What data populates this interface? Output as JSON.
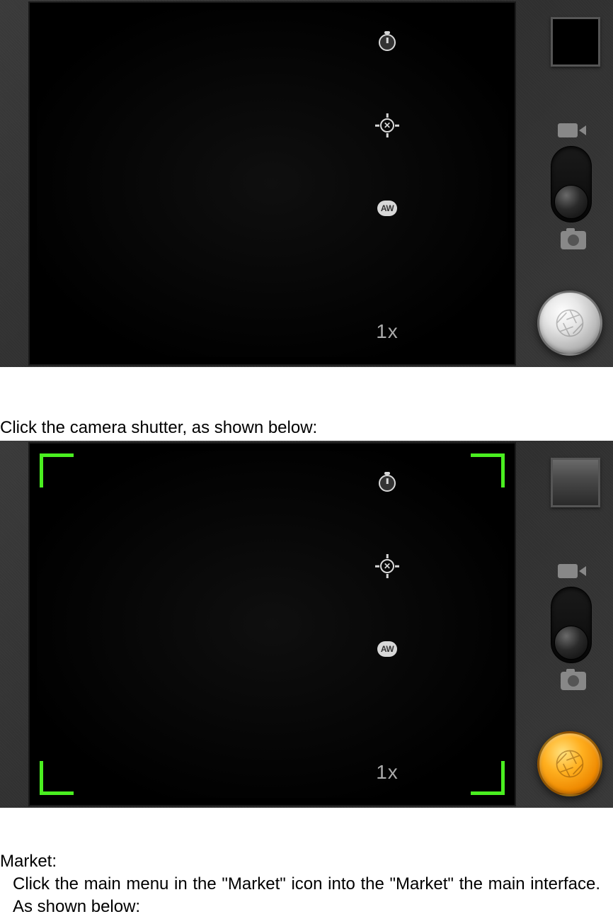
{
  "screenshot1": {
    "controls": {
      "timer_label": "timer",
      "focus_label": "focus-off",
      "focus_symbol": "✕",
      "wb_label": "AW",
      "zoom": "1x"
    },
    "shutter_state": "idle"
  },
  "caption1": "Click the camera shutter, as shown below:",
  "screenshot2": {
    "controls": {
      "timer_label": "timer",
      "focus_label": "focus-off",
      "focus_symbol": "✕",
      "wb_label": "AW",
      "zoom": "1x"
    },
    "shutter_state": "pressed",
    "focus_brackets": true
  },
  "heading2": "Market:",
  "body2": "Click the main menu in the \"Market\" icon into the \"Market\" the main interface. As shown below:"
}
